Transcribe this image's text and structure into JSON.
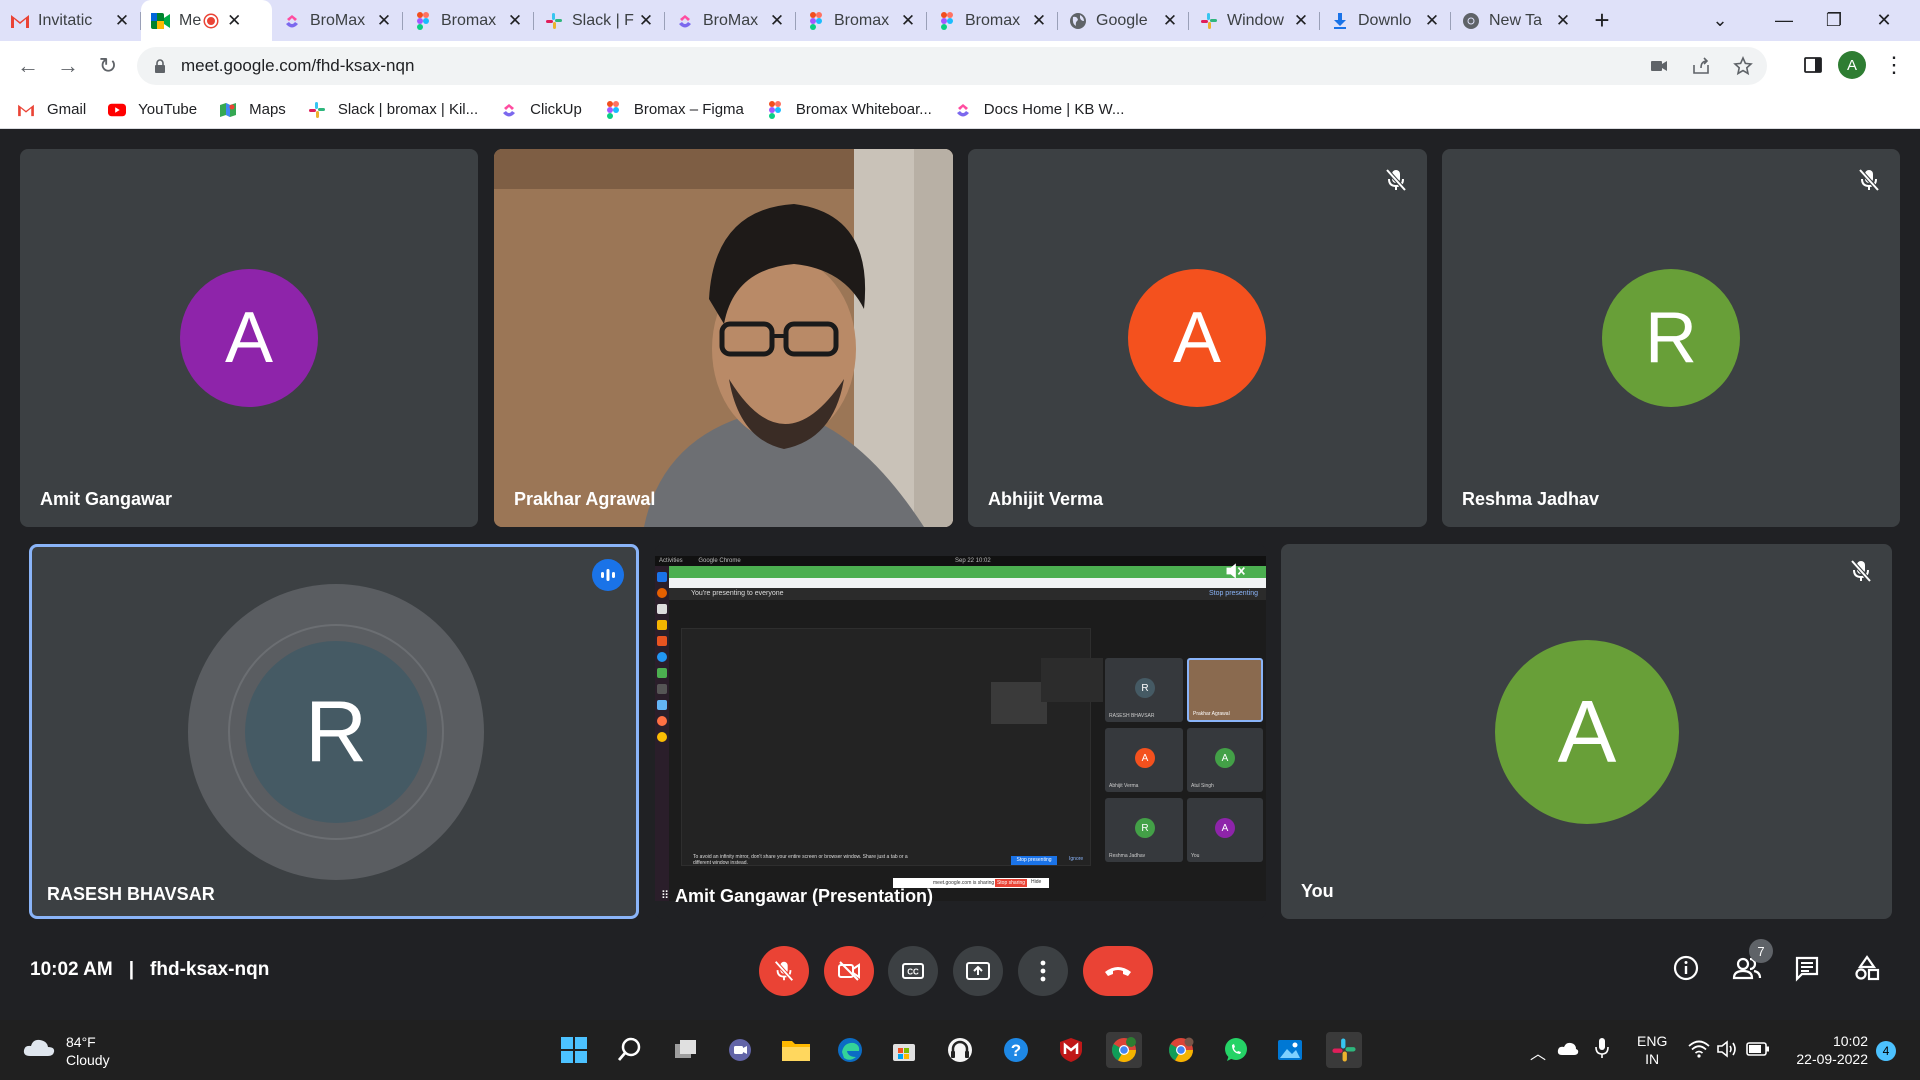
{
  "browser": {
    "tabs": [
      {
        "title": "Invitatic",
        "icon": "gmail-icon"
      },
      {
        "title": "Me",
        "icon": "meet-icon",
        "active": true,
        "recording": true
      },
      {
        "title": "BroMax",
        "icon": "clickup-icon"
      },
      {
        "title": "Bromax",
        "icon": "figma-icon"
      },
      {
        "title": "Slack | F",
        "icon": "slack-icon"
      },
      {
        "title": "BroMax",
        "icon": "clickup-icon"
      },
      {
        "title": "Bromax",
        "icon": "figma-icon"
      },
      {
        "title": "Bromax",
        "icon": "figma-icon"
      },
      {
        "title": "Google",
        "icon": "globe-icon"
      },
      {
        "title": "Window",
        "icon": "slack-icon"
      },
      {
        "title": "Downlo",
        "icon": "download-icon"
      },
      {
        "title": "New Ta",
        "icon": "chrome-icon"
      }
    ],
    "url": "meet.google.com/fhd-ksax-nqn",
    "profile_initial": "A",
    "bookmarks": [
      {
        "label": "Gmail",
        "icon": "gmail-icon"
      },
      {
        "label": "YouTube",
        "icon": "youtube-icon"
      },
      {
        "label": "Maps",
        "icon": "maps-icon"
      },
      {
        "label": "Slack | bromax | Kil...",
        "icon": "slack-icon"
      },
      {
        "label": "ClickUp",
        "icon": "clickup-icon"
      },
      {
        "label": "Bromax – Figma",
        "icon": "figma-icon"
      },
      {
        "label": "Bromax Whiteboar...",
        "icon": "figma-icon"
      },
      {
        "label": "Docs Home | KB W...",
        "icon": "clickup-icon"
      }
    ]
  },
  "meet": {
    "participants": [
      {
        "name": "Amit Gangawar",
        "initial": "A",
        "color": "#8e24aa",
        "muted": false
      },
      {
        "name": "Prakhar Agrawal",
        "initial": "",
        "video": true,
        "muted": false
      },
      {
        "name": "Abhijit Verma",
        "initial": "A",
        "color": "#f4511e",
        "muted": true
      },
      {
        "name": "Reshma Jadhav",
        "initial": "R",
        "color": "#689f38",
        "muted": true
      },
      {
        "name": "RASESH BHAVSAR",
        "initial": "R",
        "color": "#455a64",
        "speaking": true
      },
      {
        "name": "Amit Gangawar (Presentation)",
        "presentation": true
      },
      {
        "name": "You",
        "initial": "A",
        "color": "#689f38",
        "muted": true
      }
    ],
    "time": "10:02 AM",
    "separator": "|",
    "meeting_code": "fhd-ksax-nqn",
    "people_count": "7",
    "presentation_preview": {
      "banner": "You're presenting to everyone",
      "stop_label": "Stop presenting",
      "warning": "To avoid an infinity mirror, don't share your entire screen or browser window. Share just a tab or a different window instead.",
      "stop_btn": "Stop presenting",
      "ignore": "Ignore",
      "share_bar": "meet.google.com is sharing your screen.",
      "share_stop": "Stop sharing",
      "share_hide": "Hide",
      "mini_names": [
        "RASESH BHAVSAR",
        "Prakhar Agrawal",
        "Abhijit Verma",
        "Atul Singh",
        "Reshma Jadhav",
        "You"
      ],
      "mini_initials": [
        "R",
        "",
        "A",
        "A",
        "R",
        "A"
      ],
      "topbar_left": "Activities",
      "topbar_app": "Google Chrome",
      "topbar_date": "Sep 22  10:02"
    }
  },
  "taskbar": {
    "weather_temp": "84°F",
    "weather_desc": "Cloudy",
    "lang_top": "ENG",
    "lang_bottom": "IN",
    "clock_time": "10:02",
    "clock_date": "22-09-2022",
    "notif_count": "4"
  },
  "colors": {
    "meet_bg": "#202124",
    "tile_bg": "#3c4043",
    "end_call": "#ea4335",
    "speaking_border": "#8ab4f8",
    "tab_bar": "#dfe1f9"
  }
}
